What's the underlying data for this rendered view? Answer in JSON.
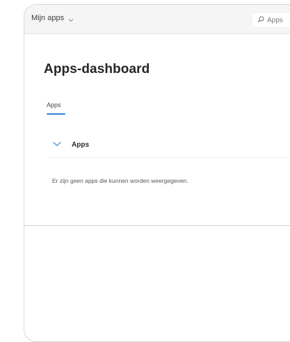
{
  "topbar": {
    "app_switcher_label": "Mijn apps",
    "search_placeholder": "Apps"
  },
  "page": {
    "title": "Apps-dashboard"
  },
  "tabs": [
    {
      "label": "Apps",
      "active": true
    }
  ],
  "section": {
    "label": "Apps",
    "expanded": true,
    "empty_message": "Er zijn geen apps die kunnen worden weergegeven."
  },
  "colors": {
    "accent": "#2f83d4",
    "topbar_bg": "#f5f5f5",
    "title_text": "#252525"
  },
  "icons": {
    "app_switcher": "chevron-down-icon",
    "search": "search-icon",
    "section_toggle": "chevron-down-icon"
  }
}
